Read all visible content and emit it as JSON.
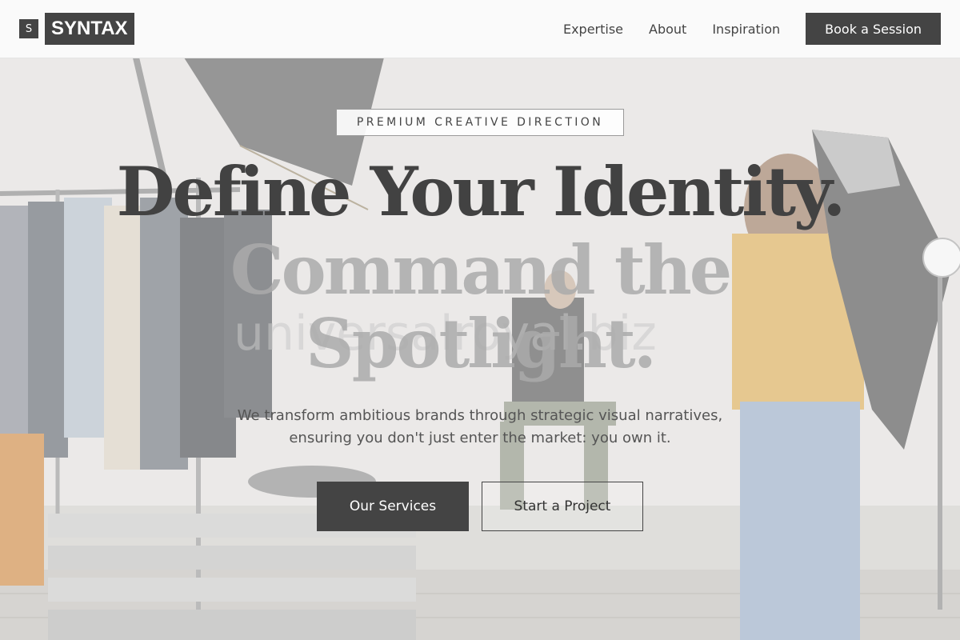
{
  "header": {
    "logo_mark": "S",
    "logo_text": "SYNTAX",
    "nav": [
      {
        "label": "Expertise"
      },
      {
        "label": "About"
      },
      {
        "label": "Inspiration"
      }
    ],
    "cta_label": "Book a Session"
  },
  "hero": {
    "eyebrow": "PREMIUM CREATIVE DIRECTION",
    "headline_line1": "Define Your Identity.",
    "headline_line2": "Command the",
    "headline_line3": "Spotlight.",
    "ghost_text": "universalroyal.biz",
    "subtitle_line1": "We transform ambitious brands through strategic visual narratives,",
    "subtitle_line2": "ensuring you don't just enter the market: you own it.",
    "primary_button": "Our Services",
    "secondary_button": "Start a Project"
  },
  "colors": {
    "primary": "#444444",
    "background": "#ffffff",
    "text": "#444444",
    "muted_headline": "#aaaaaa"
  }
}
